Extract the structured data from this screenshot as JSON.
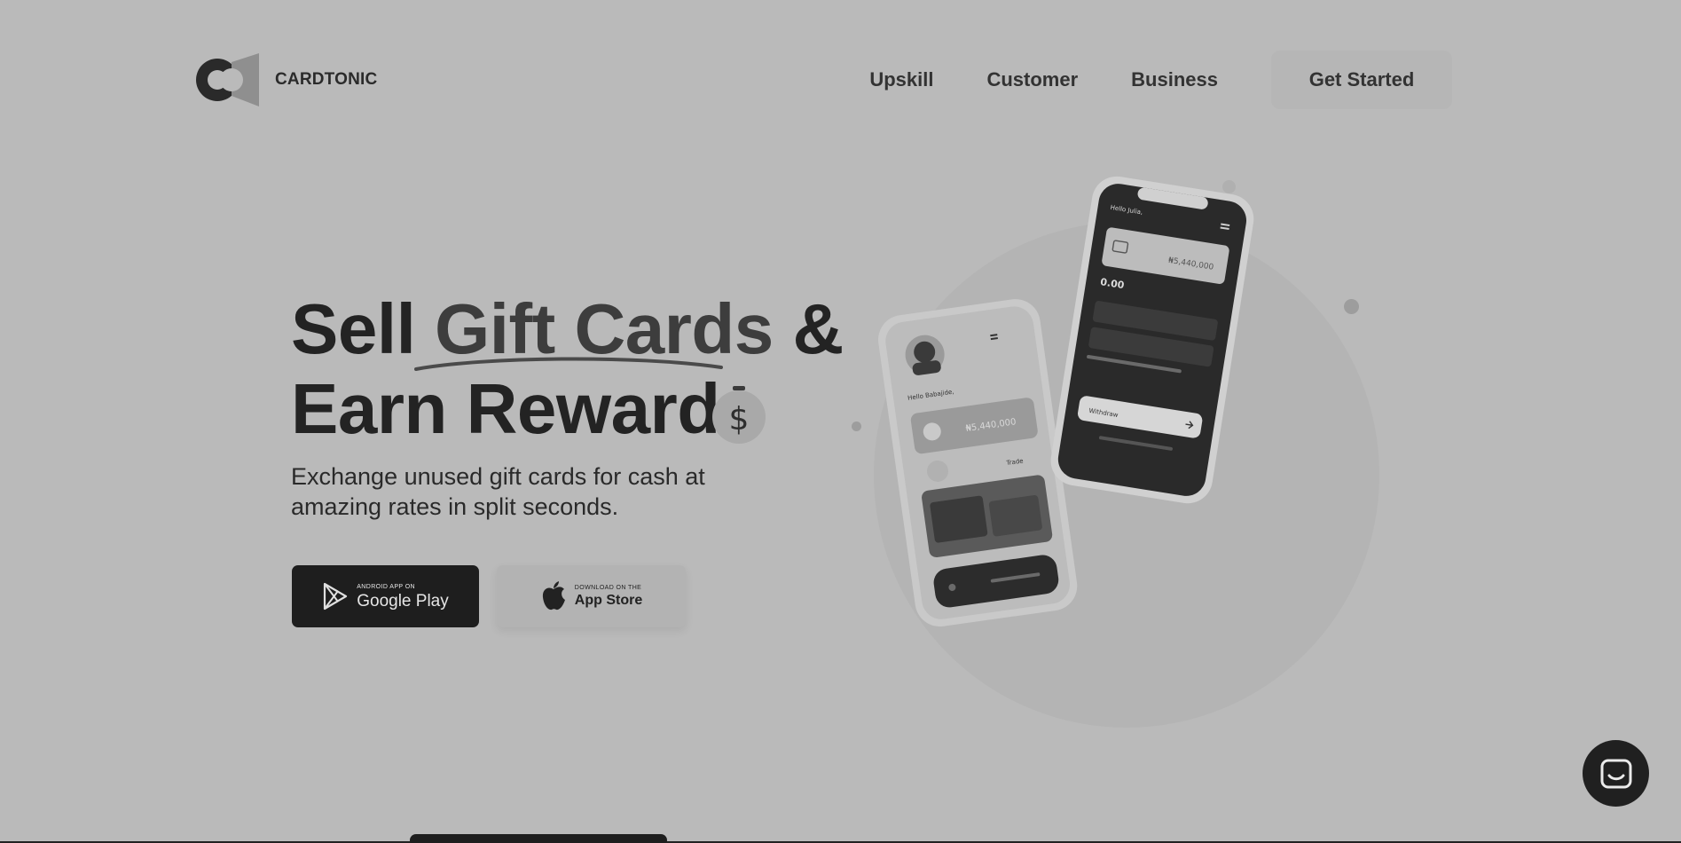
{
  "header": {
    "brand_name": "CARDTONIC",
    "nav": [
      {
        "label": "Upskill"
      },
      {
        "label": "Customer"
      },
      {
        "label": "Business"
      }
    ],
    "cta_label": "Get Started"
  },
  "hero": {
    "title_part1": "Sell",
    "title_accent": "Gift Cards",
    "title_part2": "&",
    "title_line2": "Earn Reward",
    "subtitle": "Exchange unused gift cards for cash at amazing rates in split seconds.",
    "google_play": {
      "small": "ANDROID APP ON",
      "big": "Google Play"
    },
    "app_store": {
      "small": "DOWNLOAD ON THE",
      "big": "App Store"
    }
  },
  "phone_front": {
    "greeting": "Hello Julia,",
    "balance": "₦5,440,000",
    "amount": "0.00",
    "cta": "Withdraw"
  },
  "phone_back": {
    "greeting": "Hello Babajide,",
    "balance": "₦5,440,000",
    "link": "Trade"
  },
  "icons": {
    "logo": "cardtonic-logo",
    "play": "google-play-icon",
    "apple": "apple-icon",
    "money": "money-bag-icon",
    "chat": "chat-icon"
  },
  "colors": {
    "background": "#bababa",
    "dark": "#1e1e1e",
    "text": "#2a2a2a"
  }
}
